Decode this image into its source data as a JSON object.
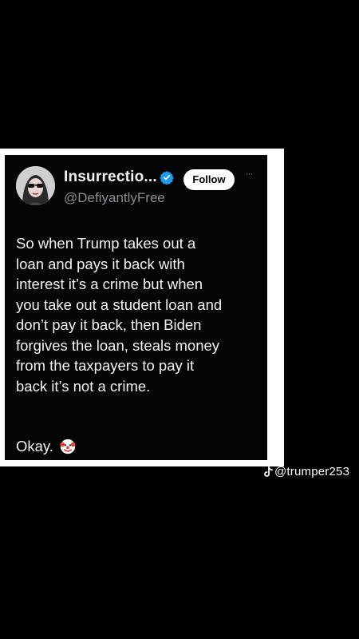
{
  "tweet": {
    "display_name": "Insurrectio...",
    "handle": "@DefiyantlyFree",
    "follow_label": "Follow",
    "more_label": "···",
    "body": "So when Trump takes out a\nloan and pays it back with\ninterest it’s a crime but when\nyou take out a student loan and\ndon’t pay it back, then Biden\nforgives the loan, steals money\nfrom the taxpayers to pay it\nback it’s not a crime.",
    "closing": "Okay.",
    "closing_emoji": "clown-face-icon",
    "verified_icon": "verified-badge-icon",
    "verified_color": "#1d9bf0"
  },
  "watermark": {
    "platform_icon": "tiktok-icon",
    "username": "@trumper253"
  },
  "colors": {
    "background": "#000000",
    "frame": "#ffffff",
    "card": "#050505",
    "text": "#f4f4f4",
    "handle": "#8a8d91"
  }
}
